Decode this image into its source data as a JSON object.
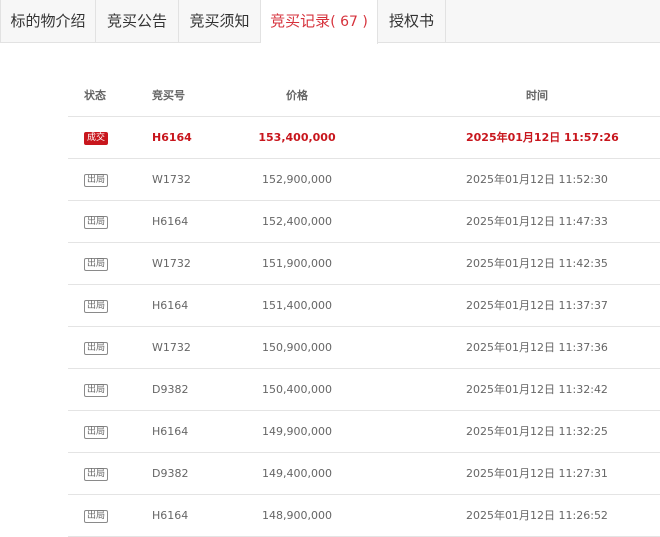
{
  "tabs": [
    {
      "label": "标的物介绍",
      "count": ""
    },
    {
      "label": "竞买公告",
      "count": ""
    },
    {
      "label": "竞买须知",
      "count": ""
    },
    {
      "label": "竞买记录",
      "count": "( 67 )"
    },
    {
      "label": "授权书",
      "count": ""
    }
  ],
  "table": {
    "headers": {
      "status": "状态",
      "bidder": "竞买号",
      "price": "价格",
      "time": "时间"
    },
    "rows": [
      {
        "status": "成交",
        "bidder": "H6164",
        "price": "153,400,000",
        "time": "2025年01月12日 11:57:26"
      },
      {
        "status": "出局",
        "bidder": "W1732",
        "price": "152,900,000",
        "time": "2025年01月12日 11:52:30"
      },
      {
        "status": "出局",
        "bidder": "H6164",
        "price": "152,400,000",
        "time": "2025年01月12日 11:47:33"
      },
      {
        "status": "出局",
        "bidder": "W1732",
        "price": "151,900,000",
        "time": "2025年01月12日 11:42:35"
      },
      {
        "status": "出局",
        "bidder": "H6164",
        "price": "151,400,000",
        "time": "2025年01月12日 11:37:37"
      },
      {
        "status": "出局",
        "bidder": "W1732",
        "price": "150,900,000",
        "time": "2025年01月12日 11:37:36"
      },
      {
        "status": "出局",
        "bidder": "D9382",
        "price": "150,400,000",
        "time": "2025年01月12日 11:32:42"
      },
      {
        "status": "出局",
        "bidder": "H6164",
        "price": "149,900,000",
        "time": "2025年01月12日 11:32:25"
      },
      {
        "status": "出局",
        "bidder": "D9382",
        "price": "149,400,000",
        "time": "2025年01月12日 11:27:31"
      },
      {
        "status": "出局",
        "bidder": "H6164",
        "price": "148,900,000",
        "time": "2025年01月12日 11:26:52"
      }
    ]
  },
  "colors": {
    "accent": "#d6323c",
    "deal_red": "#c8161d"
  }
}
